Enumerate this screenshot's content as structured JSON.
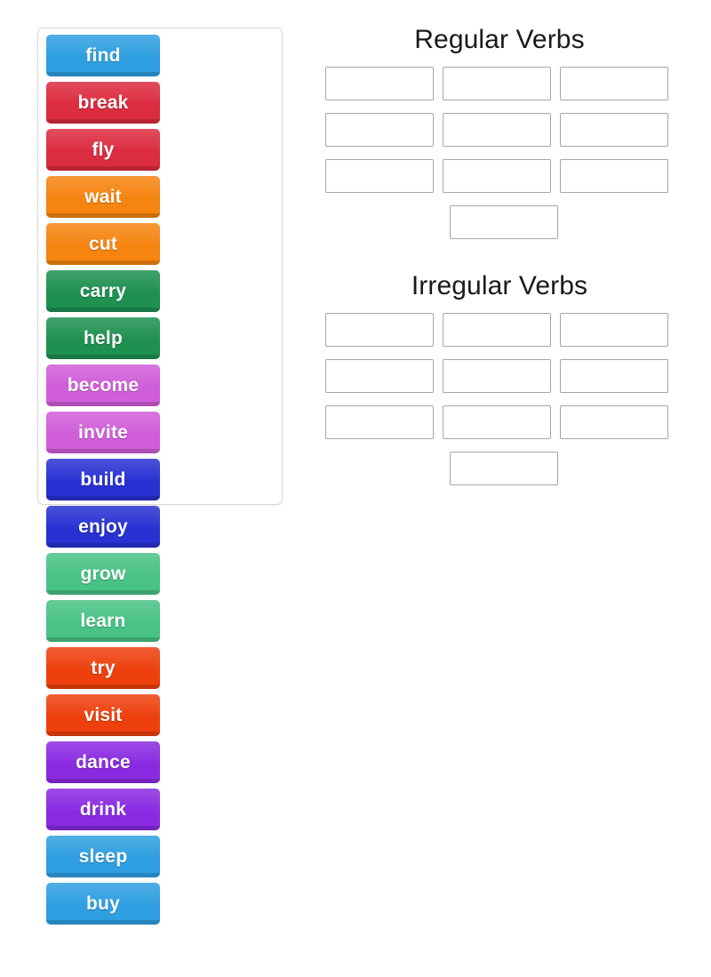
{
  "activity": {
    "type": "group-sort",
    "title_hidden": ""
  },
  "word_bank": {
    "name": "Verb tiles",
    "tiles": [
      {
        "label": "find",
        "color": "#2e9fe0"
      },
      {
        "label": "break",
        "color": "#dc2c3f"
      },
      {
        "label": "fly",
        "color": "#dc2c3f"
      },
      {
        "label": "wait",
        "color": "#f58410"
      },
      {
        "label": "cut",
        "color": "#f58410"
      },
      {
        "label": "carry",
        "color": "#1e9050"
      },
      {
        "label": "help",
        "color": "#1e9050"
      },
      {
        "label": "become",
        "color": "#d05ed8"
      },
      {
        "label": "invite",
        "color": "#d05ed8"
      },
      {
        "label": "build",
        "color": "#2832d2"
      },
      {
        "label": "enjoy",
        "color": "#2832d2"
      },
      {
        "label": "grow",
        "color": "#48c285"
      },
      {
        "label": "learn",
        "color": "#48c285"
      },
      {
        "label": "try",
        "color": "#ee400d"
      },
      {
        "label": "visit",
        "color": "#ee400d"
      },
      {
        "label": "dance",
        "color": "#8a2be2"
      },
      {
        "label": "drink",
        "color": "#8a2be2"
      },
      {
        "label": "sleep",
        "color": "#2e9fe0"
      },
      {
        "label": "buy",
        "color": "#2e9fe0"
      },
      {
        "label": "",
        "color": "transparent",
        "empty": true
      }
    ]
  },
  "groups": [
    {
      "id": "regular",
      "title": "Regular Verbs",
      "slots": [
        "",
        "",
        "",
        "",
        "",
        "",
        "",
        "",
        "",
        ""
      ]
    },
    {
      "id": "irregular",
      "title": "Irregular Verbs",
      "slots": [
        "",
        "",
        "",
        "",
        "",
        "",
        "",
        "",
        "",
        ""
      ]
    }
  ],
  "colors": {
    "page_background": "#ffffff",
    "panel_border": "#d6d6d6",
    "slot_border": "#a6a6a6",
    "heading_text": "#1a1a1a",
    "tile_text": "#ffffff"
  }
}
